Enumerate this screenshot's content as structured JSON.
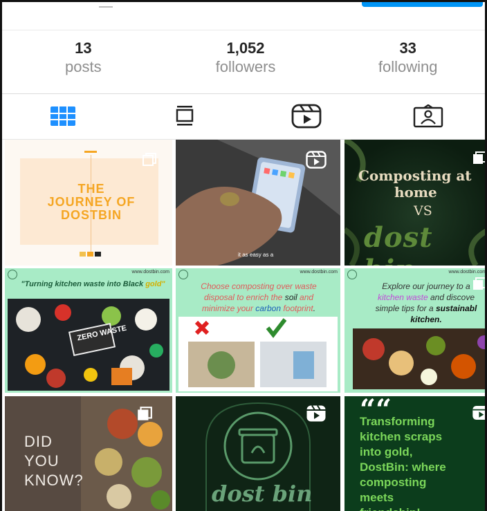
{
  "stats": {
    "posts": {
      "count": "13",
      "label": "posts"
    },
    "followers": {
      "count": "1,052",
      "label": "followers"
    },
    "following": {
      "count": "33",
      "label": "following"
    }
  },
  "tabs": [
    {
      "name": "grid-tab",
      "icon": "grid-icon",
      "active": true
    },
    {
      "name": "feed-tab",
      "icon": "feed-icon",
      "active": false
    },
    {
      "name": "reels-tab",
      "icon": "reels-icon",
      "active": false
    },
    {
      "name": "tagged-tab",
      "icon": "tagged-icon",
      "active": false
    }
  ],
  "colors": {
    "accent": "#0095f6",
    "active_tab": "#0095f6"
  },
  "posts": {
    "p1": {
      "title_lines": [
        "THE",
        "JOURNEY OF",
        "DOSTBIN"
      ]
    },
    "p2": {
      "caption": "it as easy as a"
    },
    "p3": {
      "heading_1": "Composting at",
      "heading_2": "home",
      "vs": "VS",
      "brand": "dost bin"
    },
    "p4": {
      "site": "www.dostbin.com",
      "quote_prefix": "\"Turning kitchen waste into ",
      "quote_highlight": "Black",
      "quote_end": " gold\"",
      "sign": "ZERO WASTE"
    },
    "p5": {
      "site": "www.dostbin.com",
      "line_a": "Choose composting over waste",
      "line_b_pre": "disposal to enrich the ",
      "line_b_soil": "soil",
      "line_b_post": " and",
      "line_c_pre": "minimize your ",
      "line_c_carbon": "carbon",
      "line_c_fp": " footprint",
      "line_c_end": "."
    },
    "p6": {
      "site": "www.dostbin.com",
      "line_a": "Explore our journey to a",
      "line_b_pink": "kitchen waste",
      "line_b_post": " and discove",
      "line_c_pre": "simple tips for a ",
      "line_c_bold": "sustainabl",
      "line_d": "kitchen."
    },
    "p7": {
      "lines": [
        "DID",
        "YOU",
        "KNOW?"
      ]
    },
    "p8": {
      "brand": "dost bin"
    },
    "p9": {
      "quote_mark": "““",
      "lines": [
        "Transforming",
        "kitchen scraps",
        "into gold,",
        "DostBin: where",
        "composting",
        "meets",
        "friendship!"
      ]
    }
  }
}
